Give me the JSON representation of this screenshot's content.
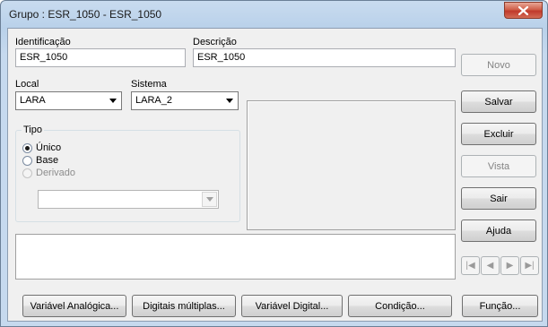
{
  "window": {
    "title": "Grupo : ESR_1050 - ESR_1050"
  },
  "form": {
    "identificacao_label": "Identificação",
    "identificacao_value": "ESR_1050",
    "descricao_label": "Descrição",
    "descricao_value": "ESR_1050",
    "local_label": "Local",
    "local_value": "LARA",
    "sistema_label": "Sistema",
    "sistema_value": "LARA_2"
  },
  "tipo": {
    "title": "Tipo",
    "options": [
      {
        "label": "Único",
        "checked": true,
        "enabled": true
      },
      {
        "label": "Base",
        "checked": false,
        "enabled": true
      },
      {
        "label": "Derivado",
        "checked": false,
        "enabled": false
      }
    ],
    "derivado_select_value": ""
  },
  "side_buttons": [
    {
      "label": "Novo",
      "enabled": false
    },
    {
      "label": "Salvar",
      "enabled": true
    },
    {
      "label": "Excluir",
      "enabled": true
    },
    {
      "label": "Vista",
      "enabled": false
    },
    {
      "label": "Sair",
      "enabled": true
    },
    {
      "label": "Ajuda",
      "enabled": true
    }
  ],
  "nav_buttons": [
    {
      "icon": "first-record-icon",
      "glyph": "|◀"
    },
    {
      "icon": "previous-record-icon",
      "glyph": "◀"
    },
    {
      "icon": "next-record-icon",
      "glyph": "▶"
    },
    {
      "icon": "last-record-icon",
      "glyph": "▶|"
    }
  ],
  "bottom_buttons": [
    "Variável Analógica...",
    "Digitais múltiplas...",
    "Variável Digital...",
    "Condição...",
    "Função..."
  ],
  "colors": {
    "title_bar": "#b9d1ea",
    "close_button": "#c0392b",
    "client_bg": "#f0f0f0"
  }
}
